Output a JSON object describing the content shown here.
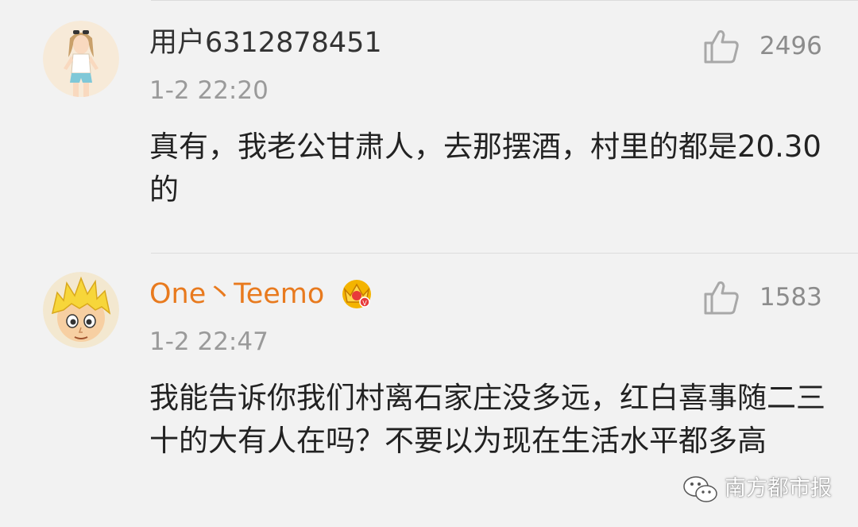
{
  "comments": [
    {
      "username": "用户6312878451",
      "timestamp": "1-2 22:20",
      "like_count": "2496",
      "text": "真有，我老公甘肃人，去那摆酒，村里的都是20.30的",
      "avatar": "avatar-girl-illustration",
      "username_color": "#333333"
    },
    {
      "username": "One丶Teemo",
      "timestamp": "1-2 22:47",
      "like_count": "1583",
      "text": "我能告诉你我们村离石家庄没多远，红白喜事随二三十的大有人在吗？不要以为现在生活水平都多高",
      "avatar": "avatar-cartoon-boy",
      "username_color": "#e87a1e",
      "badge": "vip-crown-icon"
    }
  ],
  "watermark": {
    "icon": "wechat-icon",
    "text": "南方都市报"
  },
  "colors": {
    "background": "#f2f2f2",
    "text": "#222222",
    "meta": "#9a9a9a",
    "accent_orange": "#e87a1e"
  }
}
